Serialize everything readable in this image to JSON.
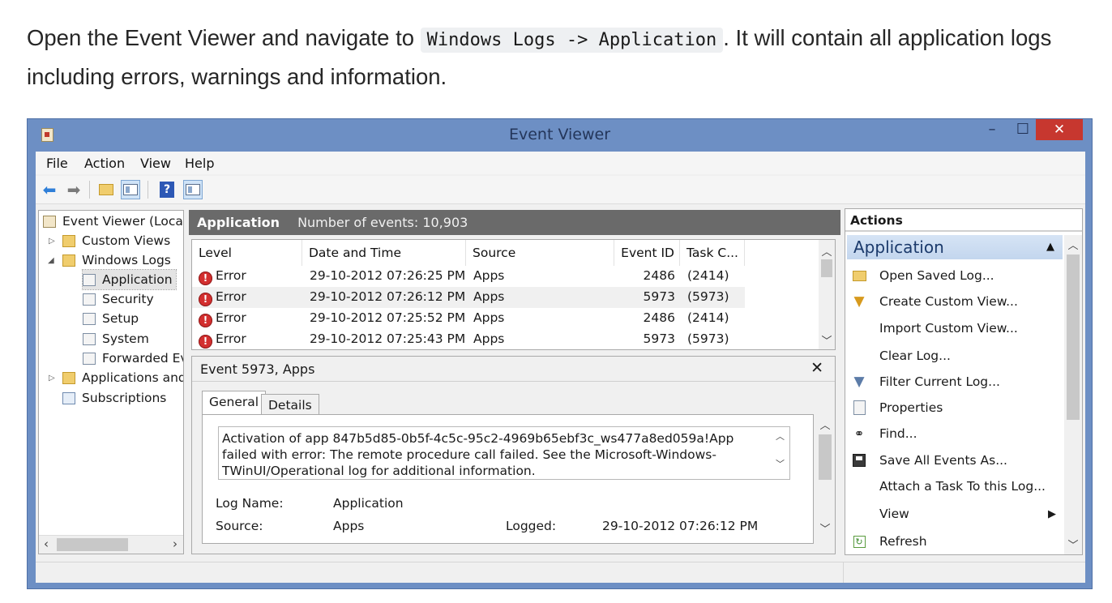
{
  "intro": {
    "text_before": "Open the Event Viewer and navigate to ",
    "code": "Windows Logs -> Application",
    "text_after": ". It will contain all application logs including errors, warnings and information."
  },
  "window": {
    "title": "Event Viewer",
    "minimize": "–",
    "maximize": "☐",
    "close": "✕"
  },
  "menu": [
    "File",
    "Action",
    "View",
    "Help"
  ],
  "tree": {
    "root": "Event Viewer (Local)",
    "custom_views": "Custom Views",
    "windows_logs": "Windows Logs",
    "application": "Application",
    "security": "Security",
    "setup": "Setup",
    "system": "System",
    "forwarded": "Forwarded Ev",
    "apps_and": "Applications and",
    "subscriptions": "Subscriptions"
  },
  "pane": {
    "title": "Application",
    "count": "Number of events: 10,903"
  },
  "list": {
    "headers": [
      "Level",
      "Date and Time",
      "Source",
      "Event ID",
      "Task C..."
    ],
    "rows": [
      {
        "level": "Error",
        "date": "29-10-2012 07:26:25 PM",
        "source": "Apps",
        "id": "2486",
        "task": "(2414)"
      },
      {
        "level": "Error",
        "date": "29-10-2012 07:26:12 PM",
        "source": "Apps",
        "id": "5973",
        "task": "(5973)"
      },
      {
        "level": "Error",
        "date": "29-10-2012 07:25:52 PM",
        "source": "Apps",
        "id": "2486",
        "task": "(2414)"
      },
      {
        "level": "Error",
        "date": "29-10-2012 07:25:43 PM",
        "source": "Apps",
        "id": "5973",
        "task": "(5973)"
      }
    ]
  },
  "detail": {
    "title": "Event 5973, Apps",
    "close": "✕",
    "tab_general": "General",
    "tab_details": "Details",
    "description": "Activation of app 847b5d85-0b5f-4c5c-95c2-4969b65ebf3c_ws477a8ed059a!App failed with error: The remote procedure call failed. See the Microsoft-Windows-TWinUI/Operational log for additional information.",
    "log_name_label": "Log Name:",
    "log_name_value": "Application",
    "source_label": "Source:",
    "source_value": "Apps",
    "logged_label": "Logged:",
    "logged_value": "29-10-2012 07:26:12 PM"
  },
  "actions": {
    "header": "Actions",
    "group": "Application",
    "items": [
      "Open Saved Log...",
      "Create Custom View...",
      "Import Custom View...",
      "Clear Log...",
      "Filter Current Log...",
      "Properties",
      "Find...",
      "Save All Events As...",
      "Attach a Task To this Log...",
      "View",
      "Refresh"
    ]
  },
  "colors": {
    "window_frame": "#6d8fc4",
    "close_button": "#c7372f",
    "pane_header": "#6a6a6a",
    "action_group": "#c3d6ee",
    "error_icon": "#d32f2f"
  }
}
